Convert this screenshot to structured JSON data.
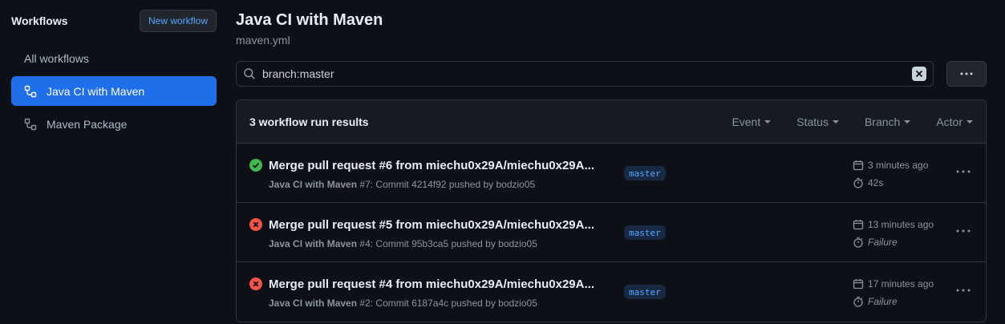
{
  "sidebar": {
    "title": "Workflows",
    "new_workflow_label": "New workflow",
    "items": [
      {
        "label": "All workflows",
        "icon": null,
        "active": false
      },
      {
        "label": "Java CI with Maven",
        "icon": "workflow-icon",
        "active": true
      },
      {
        "label": "Maven Package",
        "icon": "workflow-icon",
        "active": false
      }
    ]
  },
  "main": {
    "title": "Java CI with Maven",
    "subtitle": "maven.yml",
    "search": {
      "value": "branch:master",
      "icon": "search-icon"
    },
    "more_icon": "kebab-horizontal-icon",
    "results": {
      "count_label": "3 workflow run results",
      "filters": [
        "Event",
        "Status",
        "Branch",
        "Actor"
      ],
      "runs": [
        {
          "status": "success",
          "title": "Merge pull request #6 from miechu0x29A/miechu0x29A...",
          "workflow": "Java CI with Maven",
          "run_label": "#7: Commit 4214f92 pushed by bodzio05",
          "branch": "master",
          "time": "3 minutes ago",
          "duration": "42s",
          "duration_italic": false
        },
        {
          "status": "failure",
          "title": "Merge pull request #5 from miechu0x29A/miechu0x29A...",
          "workflow": "Java CI with Maven",
          "run_label": "#4: Commit 95b3ca5 pushed by bodzio05",
          "branch": "master",
          "time": "13 minutes ago",
          "duration": "Failure",
          "duration_italic": true
        },
        {
          "status": "failure",
          "title": "Merge pull request #4 from miechu0x29A/miechu0x29A...",
          "workflow": "Java CI with Maven",
          "run_label": "#2: Commit 6187a4c pushed by bodzio05",
          "branch": "master",
          "time": "17 minutes ago",
          "duration": "Failure",
          "duration_italic": true
        }
      ]
    }
  },
  "colors": {
    "background": "#0d1117",
    "accent": "#1f6feb",
    "link": "#58a6ff",
    "success": "#3fb950",
    "failure": "#f85149"
  }
}
